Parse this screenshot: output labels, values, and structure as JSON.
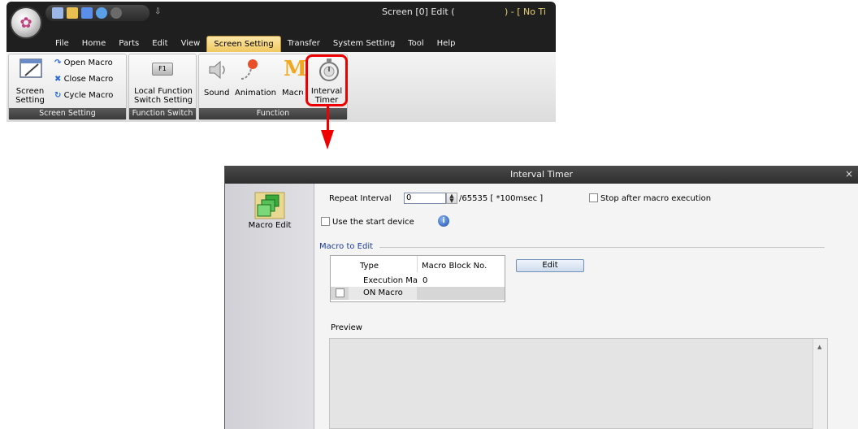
{
  "ribbon": {
    "window_title": "Screen [0] Edit (",
    "window_title_suffix": ") - [ No Ti",
    "tabs": [
      {
        "label": "File"
      },
      {
        "label": "Home"
      },
      {
        "label": "Parts"
      },
      {
        "label": "Edit"
      },
      {
        "label": "View"
      },
      {
        "label": "Screen Setting",
        "active": true
      },
      {
        "label": "Transfer"
      },
      {
        "label": "System Setting"
      },
      {
        "label": "Tool"
      },
      {
        "label": "Help"
      }
    ],
    "groups": {
      "screen_setting": {
        "caption": "Screen Setting",
        "screen_setting_line1": "Screen",
        "screen_setting_line2": "Setting",
        "open_macro": "Open Macro",
        "close_macro": "Close Macro",
        "cycle_macro": "Cycle Macro"
      },
      "function_switch": {
        "caption": "Function Switch",
        "icon_text": "F1",
        "line1": "Local Function",
        "line2": "Switch Setting"
      },
      "function": {
        "caption": "Function",
        "sound": "Sound",
        "animation": "Animation",
        "macro": "Macro",
        "macro_icon_text": "M",
        "interval_timer_line1": "Interval",
        "interval_timer_line2": "Timer"
      }
    },
    "highlight_color": "#ee0000"
  },
  "dialog": {
    "title": "Interval Timer",
    "close_glyph": "×",
    "side": {
      "macro_edit": "Macro Edit"
    },
    "repeat_interval_label": "Repeat Interval",
    "repeat_interval_value": "0",
    "repeat_interval_suffix": "/65535 [ *100msec ]",
    "stop_after_macro": "Stop after macro execution",
    "use_start_device": "Use the start device",
    "info_glyph": "i",
    "macro_to_edit": "Macro to Edit",
    "grid": {
      "headers": {
        "type": "Type",
        "block": "Macro Block No."
      },
      "rows": [
        {
          "type": "Execution Ma",
          "block": "0"
        },
        {
          "type": "ON Macro",
          "block": ""
        }
      ]
    },
    "edit_button": "Edit",
    "preview_label": "Preview",
    "scroll_up_glyph": "▲"
  }
}
